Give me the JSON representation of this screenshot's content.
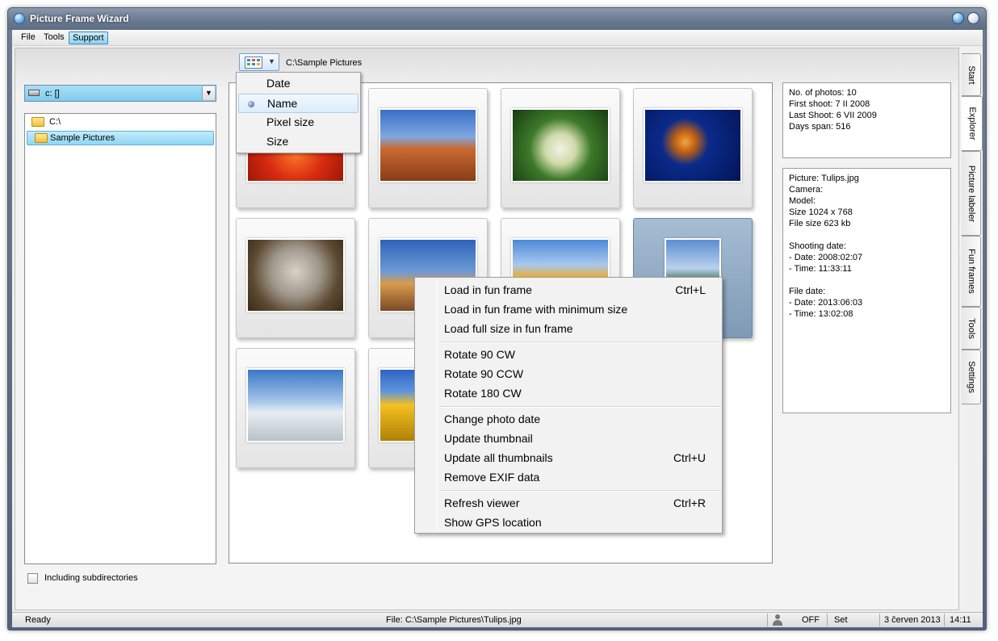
{
  "window": {
    "title": "Picture Frame Wizard"
  },
  "menubar": {
    "items": [
      "File",
      "Tools",
      "Support"
    ]
  },
  "toolbar": {
    "path": "C:\\Sample Pictures"
  },
  "drive": {
    "label": "c: []"
  },
  "tree": {
    "items": [
      "C:\\",
      "Sample Pictures"
    ]
  },
  "subdir": {
    "label": "Including subdirectories"
  },
  "sort_menu": {
    "items": [
      "Date",
      "Name",
      "Pixel size",
      "Size"
    ],
    "selected": "Name"
  },
  "context_menu": {
    "groups": [
      [
        {
          "label": "Load in fun frame",
          "shortcut": "Ctrl+L"
        },
        {
          "label": "Load in fun frame with minimum size",
          "shortcut": ""
        },
        {
          "label": "Load full size in fun frame",
          "shortcut": ""
        }
      ],
      [
        {
          "label": "Rotate 90 CW",
          "shortcut": ""
        },
        {
          "label": "Rotate 90 CCW",
          "shortcut": ""
        },
        {
          "label": "Rotate 180 CW",
          "shortcut": ""
        }
      ],
      [
        {
          "label": "Change photo date",
          "shortcut": ""
        },
        {
          "label": "Update thumbnail",
          "shortcut": ""
        },
        {
          "label": "Update all thumbnails",
          "shortcut": "Ctrl+U"
        },
        {
          "label": "Remove EXIF data",
          "shortcut": ""
        }
      ],
      [
        {
          "label": "Refresh viewer",
          "shortcut": "Ctrl+R"
        },
        {
          "label": "Show GPS location",
          "shortcut": ""
        }
      ]
    ]
  },
  "stats": {
    "lines": [
      "No. of photos: 10",
      "First shoot: 7 II 2008",
      "Last Shoot: 6 VII 2009",
      "Days span: 516"
    ]
  },
  "picture_info": {
    "lines": [
      "Picture: Tulips.jpg",
      "Camera:",
      "Model:",
      "Size 1024 x 768",
      "File size 623 kb",
      "",
      "Shooting date:",
      "- Date: 2008:02:07",
      "- Time: 11:33:11",
      "",
      "File date:",
      "- Date: 2013:06:03",
      "- Time: 13:02:08"
    ]
  },
  "tabs": [
    "Start",
    "Explorer",
    "Picture labeler",
    "Fun frames",
    "Tools",
    "Settings"
  ],
  "status": {
    "ready": "Ready",
    "file": "File: C:\\Sample Pictures\\Tulips.jpg",
    "off": "OFF",
    "set": "Set",
    "date": "3 červen 2013",
    "time": "14:11"
  },
  "thumbnails": [
    "chrysanthemum",
    "desert",
    "hydrangeas",
    "jellyfish",
    "koala",
    "lighthouse",
    "amsterdam-canal",
    "canal-selected",
    "penguins",
    "tulips"
  ],
  "colors": {
    "selection": "#8fd6f4",
    "title_bar": "#6a7a90"
  }
}
